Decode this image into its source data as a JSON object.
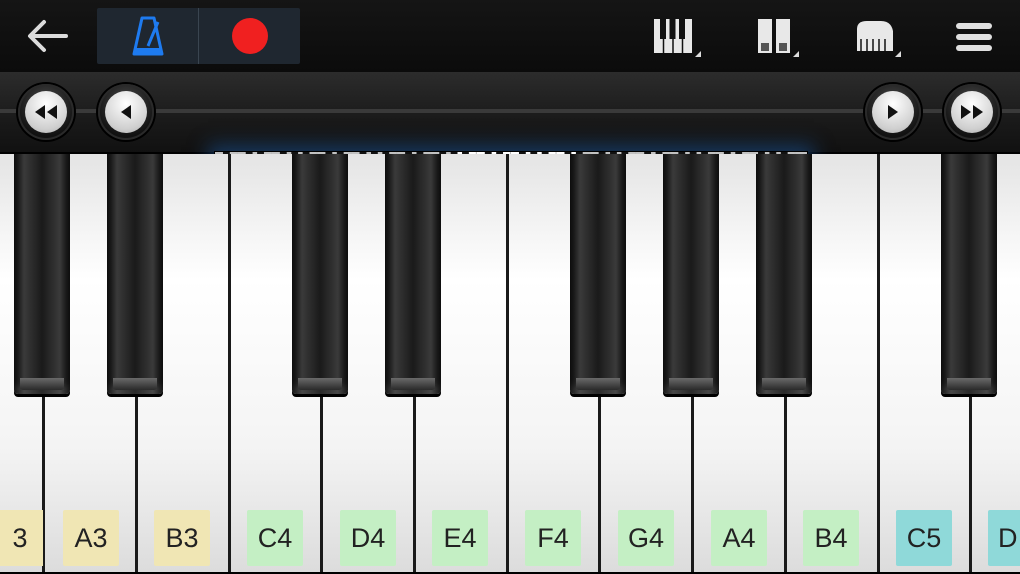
{
  "toolbar": {
    "back_icon": "back-arrow-icon",
    "metronome_icon": "metronome-icon",
    "record_icon": "record-icon",
    "keys_icon": "piano-keys-icon",
    "dual_icon": "dual-keyboard-icon",
    "instrument_icon": "grand-piano-icon",
    "menu_icon": "hamburger-menu-icon",
    "colors": {
      "metronome": "#1e7bf0",
      "record": "#f02020"
    }
  },
  "navigator": {
    "buttons": [
      "fast-rewind",
      "previous",
      "next",
      "fast-forward"
    ]
  },
  "keyboard": {
    "white_keys": [
      {
        "label": "3",
        "color": "#f0e6b4"
      },
      {
        "label": "A3",
        "color": "#f0e6b4"
      },
      {
        "label": "B3",
        "color": "#f0e6b4"
      },
      {
        "label": "C4",
        "color": "#c4efc4"
      },
      {
        "label": "D4",
        "color": "#c4efc4"
      },
      {
        "label": "E4",
        "color": "#c4efc4"
      },
      {
        "label": "F4",
        "color": "#c4efc4"
      },
      {
        "label": "G4",
        "color": "#c4efc4"
      },
      {
        "label": "A4",
        "color": "#c4efc4"
      },
      {
        "label": "B4",
        "color": "#c4efc4"
      },
      {
        "label": "C5",
        "color": "#8fd9d9"
      },
      {
        "label": "D",
        "color": "#8fd9d9"
      }
    ]
  }
}
